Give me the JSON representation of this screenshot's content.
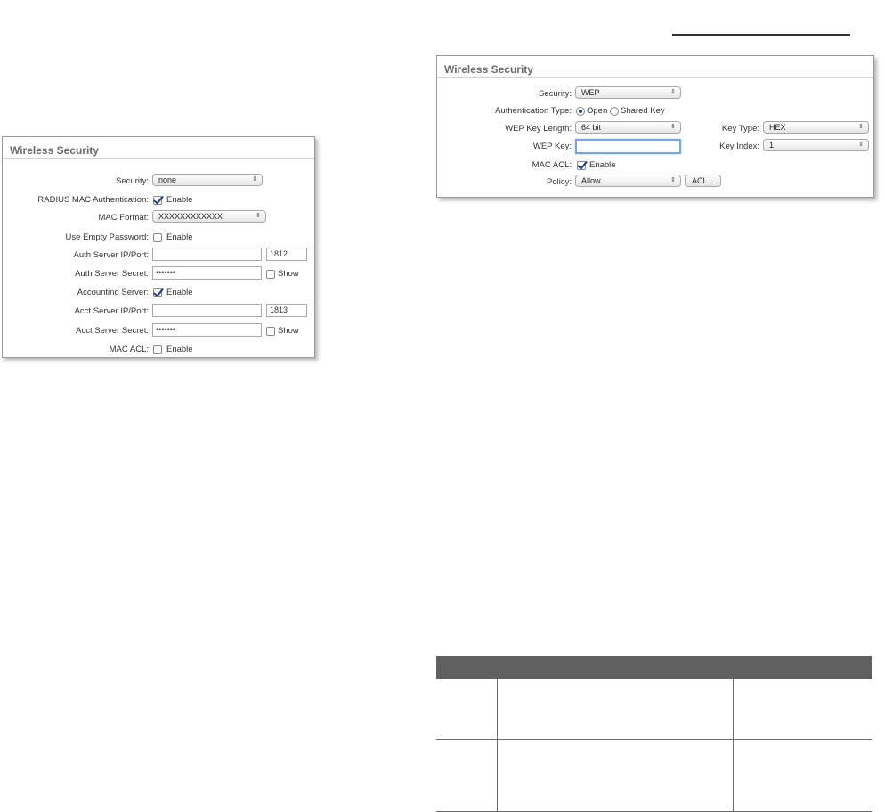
{
  "left_panel": {
    "title": "Wireless Security",
    "security": {
      "label": "Security:",
      "value": "none"
    },
    "radius_mac_auth": {
      "label": "RADIUS MAC Authentication:",
      "checked": true,
      "option": "Enable"
    },
    "mac_format": {
      "label": "MAC Format:",
      "value": "XXXXXXXXXXXX"
    },
    "use_empty_password": {
      "label": "Use Empty Password:",
      "checked": false,
      "option": "Enable"
    },
    "auth_server": {
      "label": "Auth Server IP/Port:",
      "ip": "",
      "port": "1812"
    },
    "auth_secret": {
      "label": "Auth Server Secret:",
      "value": "•••••••",
      "show_label": "Show"
    },
    "accounting_server": {
      "label": "Accounting Server:",
      "checked": true,
      "option": "Enable"
    },
    "acct_server": {
      "label": "Acct Server IP/Port:",
      "ip": "",
      "port": "1813"
    },
    "acct_secret": {
      "label": "Acct Server Secret:",
      "value": "•••••••",
      "show_label": "Show"
    },
    "mac_acl": {
      "label": "MAC ACL:",
      "checked": false,
      "option": "Enable"
    }
  },
  "right_panel": {
    "title": "Wireless Security",
    "security": {
      "label": "Security:",
      "value": "WEP"
    },
    "auth_type": {
      "label": "Authentication Type:",
      "option_open": "Open",
      "option_shared": "Shared Key",
      "selected": "Open"
    },
    "wep_key_length": {
      "label": "WEP Key Length:",
      "value": "64 bit"
    },
    "key_type": {
      "label": "Key Type:",
      "value": "HEX"
    },
    "wep_key": {
      "label": "WEP Key:",
      "value": ""
    },
    "key_index": {
      "label": "Key Index:",
      "value": "1"
    },
    "mac_acl": {
      "label": "MAC ACL:",
      "checked": true,
      "option": "Enable"
    },
    "policy": {
      "label": "Policy:",
      "value": "Allow",
      "acl_button": "ACL..."
    }
  },
  "icons": {
    "select_arrows": "⇕"
  }
}
